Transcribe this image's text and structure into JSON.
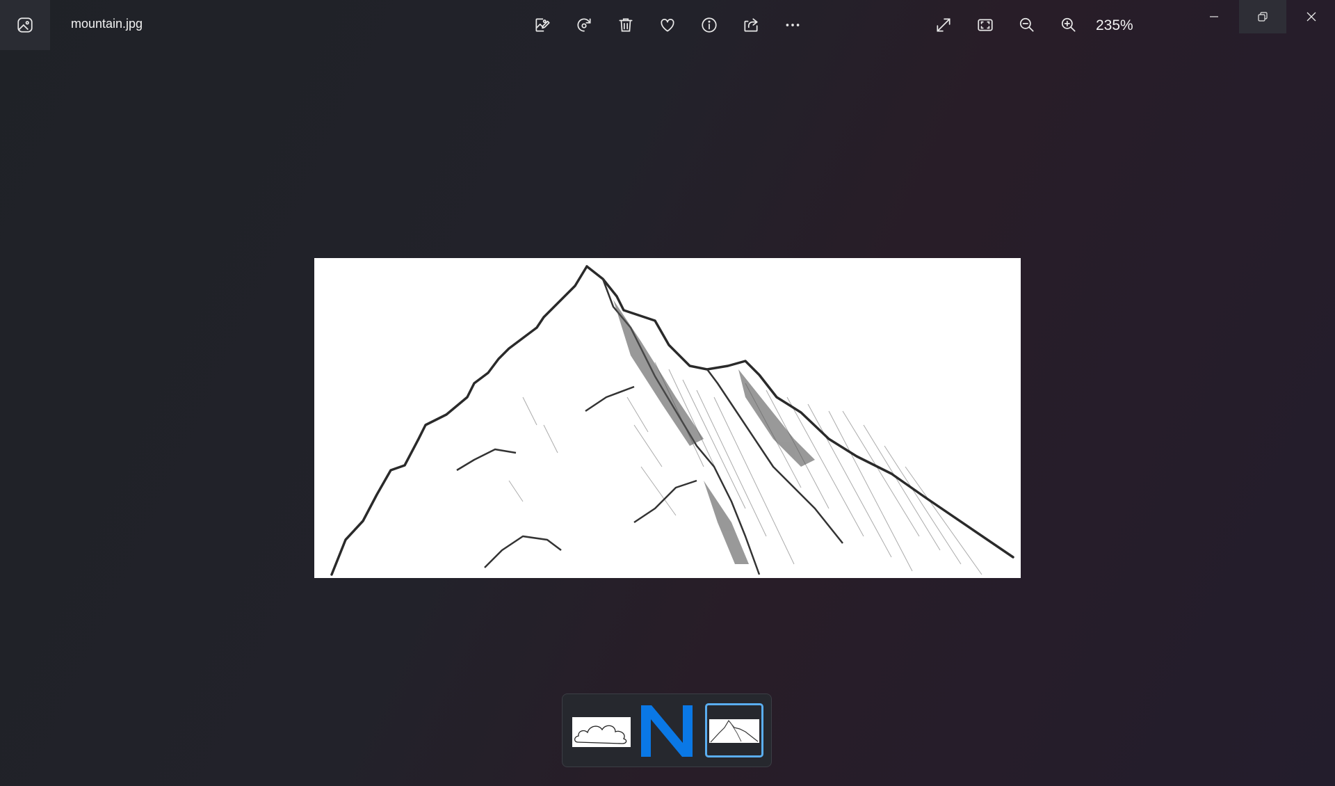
{
  "window": {
    "file_name": "mountain.jpg",
    "app_icon": "photos-app-icon"
  },
  "toolbar": {
    "actions": [
      {
        "name": "edit-image",
        "icon": "edit-image-icon"
      },
      {
        "name": "rotate",
        "icon": "rotate-icon"
      },
      {
        "name": "delete",
        "icon": "trash-icon"
      },
      {
        "name": "favorite",
        "icon": "heart-icon"
      },
      {
        "name": "file-info",
        "icon": "info-icon"
      },
      {
        "name": "share",
        "icon": "share-icon"
      },
      {
        "name": "see-more",
        "icon": "more-icon"
      }
    ],
    "view": [
      {
        "name": "full-screen",
        "icon": "expand-icon"
      },
      {
        "name": "fit-to-window",
        "icon": "fit-window-icon"
      },
      {
        "name": "zoom-out",
        "icon": "zoom-out-icon"
      },
      {
        "name": "zoom-in",
        "icon": "zoom-in-icon"
      }
    ],
    "zoom_level": "235%"
  },
  "window_controls": [
    "minimize-icon",
    "restore-icon",
    "close-icon"
  ],
  "viewer": {
    "image_subject": "pencil sketch of a mountain peak"
  },
  "filmstrip": {
    "thumbnails": [
      {
        "subject": "cloud outline drawing",
        "selected": false
      },
      {
        "subject": "blue letter N",
        "selected": false
      },
      {
        "subject": "mountain sketch",
        "selected": true
      }
    ]
  },
  "colors": {
    "accent": "#5aaef0",
    "n_blue": "#0a78e6",
    "background": "#202227"
  }
}
